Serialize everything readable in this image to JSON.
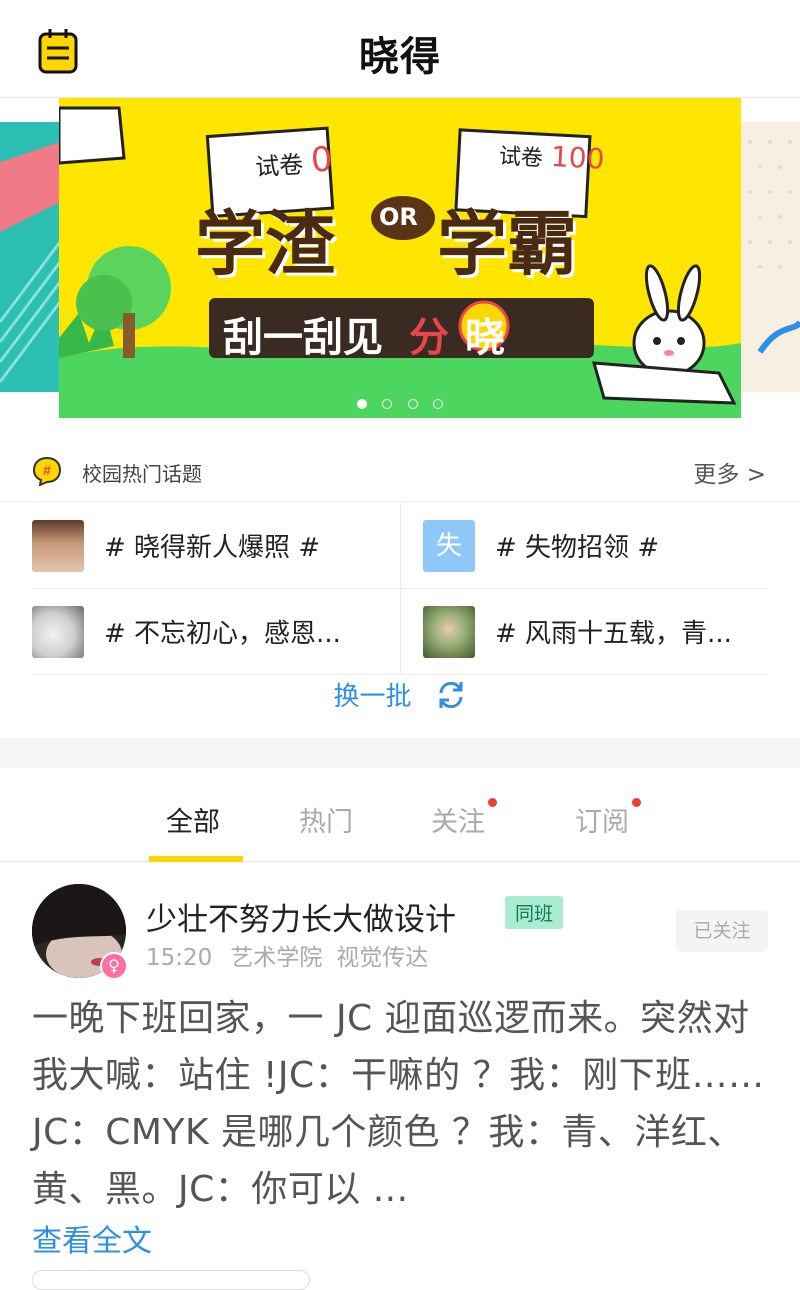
{
  "header": {
    "title": "晓得"
  },
  "banner": {
    "line1_left": "学渣",
    "or": "OR",
    "line1_right": "学霸",
    "line2_a": "刮一刮见",
    "line2_b": "分",
    "line2_c": "晓",
    "paper_left": "试卷",
    "paper_left_score": "0",
    "paper_right": "试卷",
    "paper_right_score": "100",
    "dots_count": 4,
    "active_dot": 0
  },
  "hot_topics": {
    "label": "校园热门话题",
    "more": "更多 >",
    "items": [
      {
        "text": "# 晓得新人爆照 #",
        "thumb": "photo"
      },
      {
        "text": "# 失物招领 #",
        "thumb": "失"
      },
      {
        "text": "# 不忘初心，感恩...",
        "thumb": "photo"
      },
      {
        "text": "# 风雨十五载，青...",
        "thumb": "photo"
      }
    ],
    "refresh_label": "换一批"
  },
  "tabs": [
    {
      "label": "全部",
      "active": true,
      "dot": false
    },
    {
      "label": "热门",
      "active": false,
      "dot": false
    },
    {
      "label": "关注",
      "active": false,
      "dot": true
    },
    {
      "label": "订阅",
      "active": false,
      "dot": true
    }
  ],
  "post": {
    "username": "少壮不努力长大做设计",
    "badge": "同班",
    "time": "15:20",
    "college": "艺术学院",
    "major": "视觉传达",
    "follow_label": "已关注",
    "gender_symbol": "♀",
    "content": "一晚下班回家，一 JC 迎面巡逻而来。突然对我大喊：站住 !JC：干嘛的 ？我：刚下班…… JC：CMYK 是哪几个颜色 ？我：青、洋红、黄、黑。JC：你可以 ...",
    "read_more": "查看全文"
  },
  "colors": {
    "accent_blue": "#2f8fe6",
    "tab_underline": "#ffd600",
    "banner_bg": "#ffe600",
    "red_dot": "#f23b3b"
  }
}
